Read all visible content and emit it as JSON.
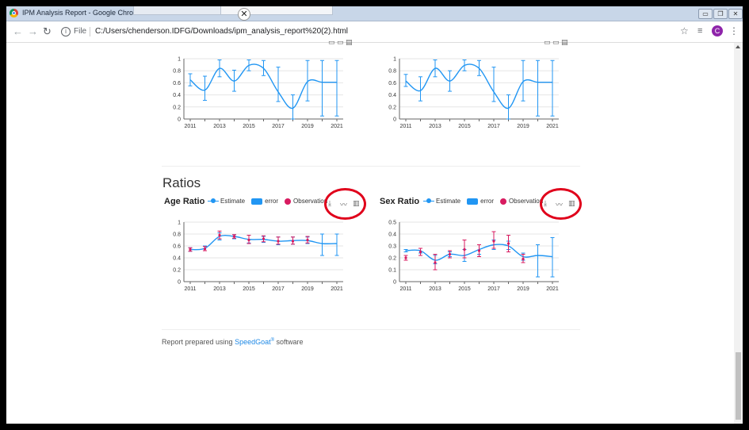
{
  "browser": {
    "window_title": "IPM Analysis Report - Google Chrome",
    "file_label": "File",
    "url": "C:/Users/chenderson.IDFG/Downloads/ipm_analysis_report%20(2).html",
    "avatar_letter": "C",
    "icons": [
      "back-arrow-icon",
      "forward-arrow-icon",
      "reload-icon",
      "info-icon",
      "star-icon",
      "media-icon",
      "menu-icon"
    ]
  },
  "page": {
    "ratios_title": "Ratios",
    "footer": {
      "prefix": "Report prepared using ",
      "link": "SpeedGoat",
      "mark": "®",
      "suffix": " software"
    },
    "legend": {
      "estimate": "Estimate",
      "error": "error",
      "observation": "Observation"
    },
    "highlight_color": "#e0001b",
    "accent_color": "#2196f3",
    "observation_color": "#d81b60"
  },
  "chart_data": [
    {
      "type": "line",
      "title": "",
      "x": [
        2011,
        2012,
        2013,
        2014,
        2015,
        2016,
        2017,
        2018,
        2019,
        2020,
        2021
      ],
      "xticks": [
        "2011",
        "2013",
        "2015",
        "2017",
        "2019",
        "2021"
      ],
      "ylim": [
        0,
        1
      ],
      "yticks": [
        "0",
        "0.2",
        "0.4",
        "0.6",
        "0.8",
        "1"
      ],
      "series": [
        {
          "values": [
            0.65,
            0.48,
            0.84,
            0.63,
            0.89,
            0.84,
            0.45,
            0.18,
            0.62,
            0.61,
            0.61
          ],
          "err_low": [
            0.55,
            0.31,
            0.7,
            0.46,
            0.8,
            0.72,
            0.29,
            0.0,
            0.3,
            0.05,
            0.05
          ],
          "err_high": [
            0.75,
            0.71,
            0.98,
            0.81,
            0.98,
            0.97,
            0.86,
            0.4,
            0.97,
            0.97,
            0.97
          ]
        }
      ]
    },
    {
      "type": "line",
      "title": "",
      "x": [
        2011,
        2012,
        2013,
        2014,
        2015,
        2016,
        2017,
        2018,
        2019,
        2020,
        2021
      ],
      "xticks": [
        "2011",
        "2013",
        "2015",
        "2017",
        "2019",
        "2021"
      ],
      "ylim": [
        0,
        1
      ],
      "yticks": [
        "0",
        "0.2",
        "0.4",
        "0.6",
        "0.8",
        "1"
      ],
      "series": [
        {
          "values": [
            0.63,
            0.47,
            0.84,
            0.63,
            0.89,
            0.84,
            0.45,
            0.18,
            0.62,
            0.61,
            0.61
          ],
          "err_low": [
            0.54,
            0.3,
            0.7,
            0.46,
            0.8,
            0.72,
            0.29,
            0.0,
            0.3,
            0.05,
            0.05
          ],
          "err_high": [
            0.74,
            0.7,
            0.98,
            0.8,
            0.98,
            0.97,
            0.86,
            0.4,
            0.97,
            0.97,
            0.97
          ]
        }
      ]
    },
    {
      "type": "line",
      "title": "Age Ratio",
      "x": [
        2011,
        2012,
        2013,
        2014,
        2015,
        2016,
        2017,
        2018,
        2019,
        2020,
        2021
      ],
      "xticks": [
        "2011",
        "2013",
        "2015",
        "2017",
        "2019",
        "2021"
      ],
      "ylim": [
        0,
        1
      ],
      "yticks": [
        "0",
        "0.2",
        "0.4",
        "0.6",
        "0.8",
        "1"
      ],
      "series": [
        {
          "name": "Estimate",
          "values": [
            0.54,
            0.56,
            0.76,
            0.76,
            0.71,
            0.71,
            0.68,
            0.69,
            0.69,
            0.64,
            0.64
          ],
          "err_low": [
            0.51,
            0.52,
            0.7,
            0.72,
            0.65,
            0.66,
            0.62,
            0.63,
            0.64,
            0.44,
            0.44
          ],
          "err_high": [
            0.57,
            0.6,
            0.82,
            0.79,
            0.78,
            0.76,
            0.75,
            0.75,
            0.75,
            0.8,
            0.8
          ]
        },
        {
          "name": "Observation",
          "values": [
            0.54,
            0.55,
            0.78,
            0.76,
            0.7,
            0.72,
            0.68,
            0.68,
            0.7,
            null,
            null
          ],
          "err_low": [
            0.51,
            0.52,
            0.72,
            0.73,
            0.64,
            0.67,
            0.63,
            0.63,
            0.65,
            null,
            null
          ],
          "err_high": [
            0.57,
            0.59,
            0.85,
            0.79,
            0.78,
            0.77,
            0.75,
            0.75,
            0.76,
            null,
            null
          ]
        }
      ]
    },
    {
      "type": "line",
      "title": "Sex Ratio",
      "x": [
        2011,
        2012,
        2013,
        2014,
        2015,
        2016,
        2017,
        2018,
        2019,
        2020,
        2021
      ],
      "xticks": [
        "2011",
        "2013",
        "2015",
        "2017",
        "2019",
        "2021"
      ],
      "ylim": [
        0,
        0.5
      ],
      "yticks": [
        "0",
        "0.1",
        "0.2",
        "0.3",
        "0.4",
        "0.5"
      ],
      "series": [
        {
          "name": "Estimate",
          "values": [
            0.26,
            0.26,
            0.18,
            0.23,
            0.22,
            0.27,
            0.31,
            0.3,
            0.21,
            0.22,
            0.21
          ],
          "err_low": [
            0.25,
            0.24,
            0.15,
            0.21,
            0.17,
            0.23,
            0.27,
            0.27,
            0.18,
            0.04,
            0.04
          ],
          "err_high": [
            0.27,
            0.28,
            0.22,
            0.25,
            0.27,
            0.31,
            0.35,
            0.34,
            0.24,
            0.31,
            0.37
          ]
        },
        {
          "name": "Observation",
          "values": [
            0.2,
            0.25,
            0.16,
            0.23,
            0.27,
            0.26,
            0.34,
            0.32,
            0.19,
            null,
            null
          ],
          "err_low": [
            0.18,
            0.22,
            0.1,
            0.2,
            0.2,
            0.21,
            0.28,
            0.25,
            0.16,
            null,
            null
          ],
          "err_high": [
            0.22,
            0.28,
            0.23,
            0.26,
            0.35,
            0.31,
            0.42,
            0.39,
            0.23,
            null,
            null
          ]
        }
      ]
    }
  ]
}
